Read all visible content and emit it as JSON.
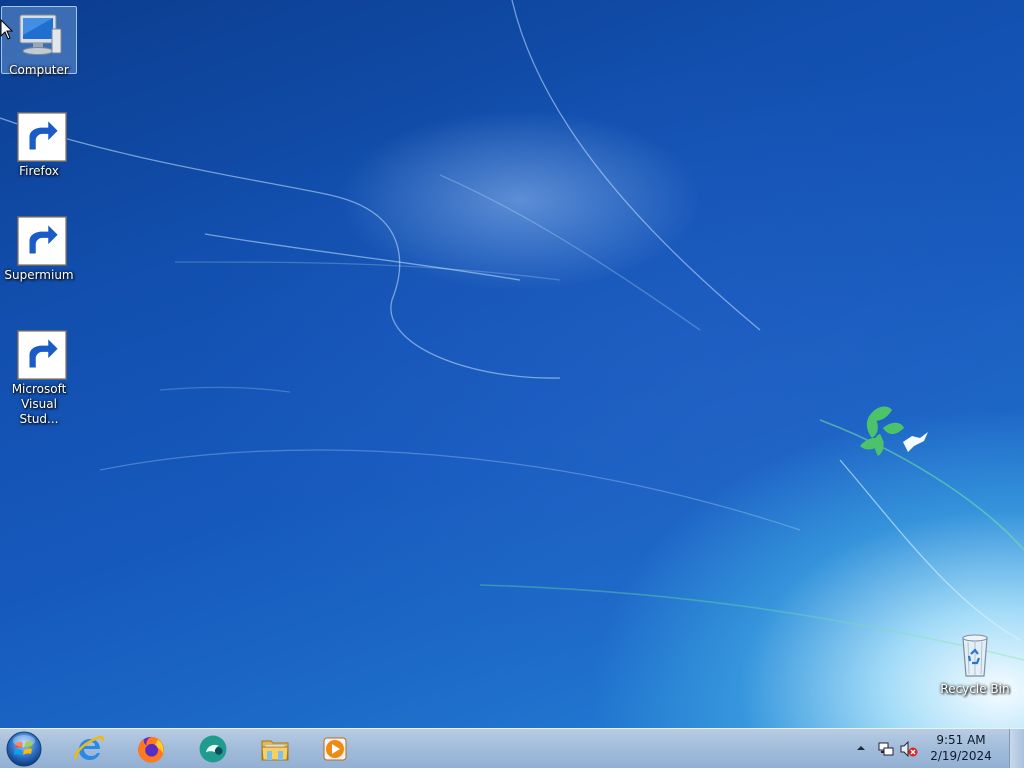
{
  "desktop": {
    "icons": [
      {
        "label": "Computer",
        "icon": "computer-icon",
        "selected": true
      },
      {
        "label": "Firefox",
        "icon": "firefox-icon",
        "shortcut": true
      },
      {
        "label": "Supermium",
        "icon": "supermium-icon",
        "shortcut": true
      },
      {
        "label": "Microsoft Visual Stud...",
        "icon": "visual-studio-icon",
        "shortcut": true
      },
      {
        "label": "Recycle Bin",
        "icon": "recycle-bin-icon"
      }
    ]
  },
  "taskbar": {
    "start_button": "windows-orb-icon",
    "pinned": [
      {
        "name": "Internet Explorer",
        "icon": "internet-explorer-icon"
      },
      {
        "name": "Firefox",
        "icon": "firefox-icon"
      },
      {
        "name": "Supermium",
        "icon": "supermium-icon"
      },
      {
        "name": "Windows Explorer",
        "icon": "folder-icon"
      },
      {
        "name": "Windows Media Player",
        "icon": "media-player-icon"
      }
    ],
    "tray": {
      "time": "9:51 AM",
      "date": "2/19/2024",
      "icons": [
        "show-hidden-icons-arrow",
        "network-icon",
        "volume-muted-icon"
      ]
    }
  },
  "colors": {
    "desktop_base": "#1659bd",
    "taskbar": "#a3bddb",
    "glow": "#aee1fa"
  }
}
